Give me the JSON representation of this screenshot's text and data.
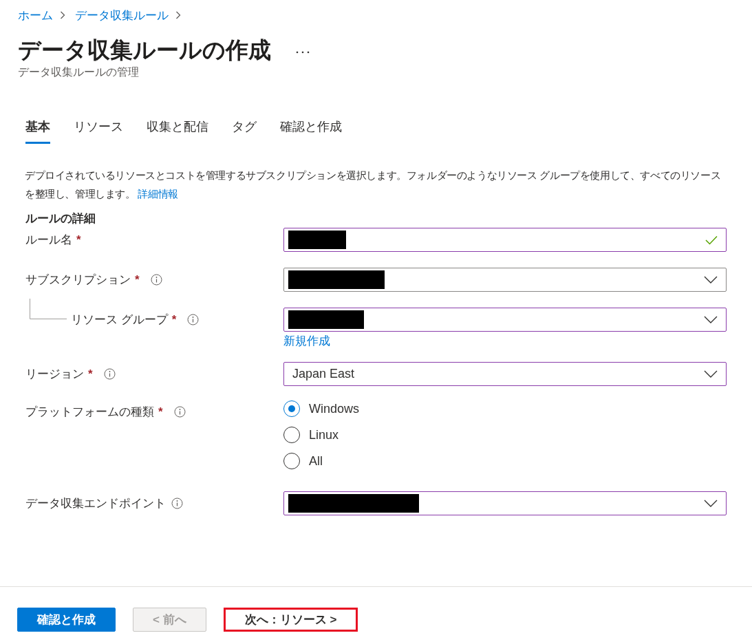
{
  "breadcrumb": [
    {
      "label": "ホーム"
    },
    {
      "label": "データ収集ルール"
    }
  ],
  "title": "データ収集ルールの作成",
  "subtitle": "データ収集ルールの管理",
  "tabs": [
    {
      "label": "基本",
      "selected": true
    },
    {
      "label": "リソース",
      "selected": false
    },
    {
      "label": "収集と配信",
      "selected": false
    },
    {
      "label": "タグ",
      "selected": false
    },
    {
      "label": "確認と作成",
      "selected": false
    }
  ],
  "description": {
    "text": "デプロイされているリソースとコストを管理するサブスクリプションを選択します。フォルダーのようなリソース グループを使用して、すべてのリソースを整理し、管理します。",
    "link": "詳細情報"
  },
  "section_title": "ルールの詳細",
  "fields": [
    {
      "kind": "text",
      "label": "ルール名",
      "required": "*",
      "info": false,
      "edited": true,
      "valid": true,
      "redacted": true
    },
    {
      "kind": "dropdown",
      "label": "サブスクリプション",
      "required": "*",
      "info": true,
      "edited": false,
      "redacted": true
    },
    {
      "kind": "dropdown",
      "label": "リソース グループ",
      "required": "*",
      "info": true,
      "edited": true,
      "redacted": true,
      "nested": true,
      "link": "新規作成"
    },
    {
      "kind": "dropdown",
      "label": "リージョン",
      "required": "*",
      "info": true,
      "edited": true,
      "value": "Japan East"
    },
    {
      "kind": "radio",
      "label": "プラットフォームの種類",
      "required": "*",
      "info": true,
      "options": [
        {
          "label": "Windows",
          "selected": true
        },
        {
          "label": "Linux",
          "selected": false
        },
        {
          "label": "All",
          "selected": false
        }
      ]
    },
    {
      "kind": "dropdown",
      "label": "データ収集エンドポイント",
      "info": true,
      "edited": true,
      "redacted": true
    }
  ],
  "buttons": [
    {
      "label": "確認と作成",
      "kind": "primary",
      "disabled": false,
      "highlighted": false
    },
    {
      "label": "< 前へ",
      "kind": "secondary",
      "disabled": true,
      "highlighted": false
    },
    {
      "label": "次へ：リソース >",
      "kind": "secondary",
      "disabled": false,
      "highlighted": true
    }
  ]
}
